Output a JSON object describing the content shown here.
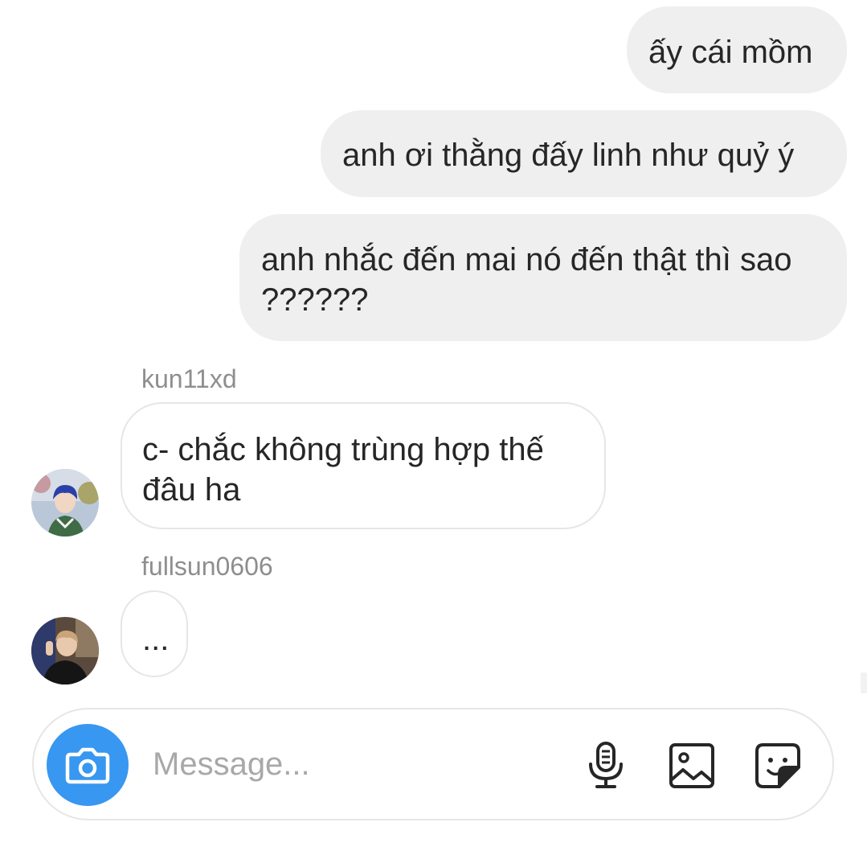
{
  "thread": {
    "outgoing": [
      {
        "text": "ấy cái mồm"
      },
      {
        "text": "anh ơi thằng đấy linh như quỷ ý"
      },
      {
        "text": "anh nhắc đến mai nó đến thật thì sao ??????"
      }
    ],
    "incoming": [
      {
        "sender": "kun11xd",
        "text": "c- chắc không trùng hợp thế đâu ha",
        "avatar_icon": "user-avatar-photo"
      },
      {
        "sender": "fullsun0606",
        "text": "...",
        "avatar_icon": "user-avatar-photo"
      }
    ]
  },
  "composer": {
    "placeholder": "Message...",
    "value": "",
    "camera_icon": "camera-icon",
    "mic_icon": "microphone-icon",
    "gallery_icon": "image-icon",
    "sticker_icon": "sticker-icon",
    "accent_color": "#3897f0"
  },
  "colors": {
    "outgoing_bubble": "#efefef",
    "incoming_border": "#e6e6e6",
    "sender_name": "#8e8e8e",
    "placeholder": "#a8a8a8"
  }
}
